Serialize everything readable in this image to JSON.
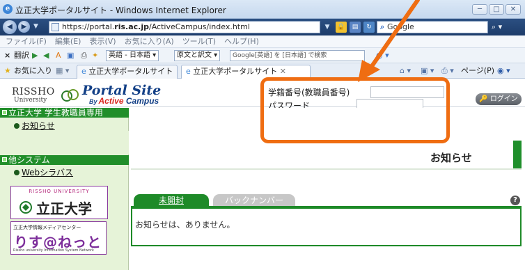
{
  "browser": {
    "title": "立正大学ポータルサイト - Windows Internet Explorer",
    "window_buttons": [
      "─",
      "□",
      "✕"
    ],
    "address_prefix": "https://portal.",
    "address_domain": "ris.ac.jp",
    "address_path": "/ActiveCampus/index.html",
    "search_placeholder": "Google",
    "menu": [
      "ファイル(F)",
      "編集(E)",
      "表示(V)",
      "お気に入り(A)",
      "ツール(T)",
      "ヘルプ(H)"
    ],
    "toolbar": {
      "close_x": "×",
      "translate": "翻訳",
      "lang_select": "英語 - 日本語",
      "mode_select": "原文と訳文",
      "search_field": "Google[英語] を [日本語] で検索"
    },
    "favbar": {
      "favorites": "お気に入り",
      "tab1": "立正大学ポータルサイト",
      "tab2": "立正大学ポータルサイト",
      "page_menu": "ページ(P)"
    }
  },
  "portal": {
    "logo": {
      "rissho": "RISSHO",
      "university": "University",
      "portal_site": "Portal Site",
      "by": "By",
      "active": "Active",
      "campus": "Campus"
    },
    "login": {
      "student_id_label": "学籍番号(教職員番号)",
      "password_label": "パスワード",
      "login_button": "ログイン"
    },
    "sidebar": {
      "section1_title": "立正大学 学生教職員専用",
      "section1_link": "お知らせ",
      "section2_title": "他システム",
      "section2_link": "Webシラバス"
    },
    "banners": {
      "rissho_top": "RISSHO UNIVERSITY",
      "rissho_name": "立正大学",
      "media_top": "立正大学情報メディアセンター",
      "media_name": "りす@ねっと",
      "media_foot": "Rissho university Information System Network"
    },
    "main": {
      "title": "お知らせ",
      "tab_unread": "未開封",
      "tab_back": "バックナンバー",
      "help": "?",
      "empty_message": "お知らせは、ありません。"
    }
  },
  "colors": {
    "annotation": "#ef6d12",
    "portal_green": "#1e8a28",
    "sidebar_bg": "#e6f3d8"
  }
}
